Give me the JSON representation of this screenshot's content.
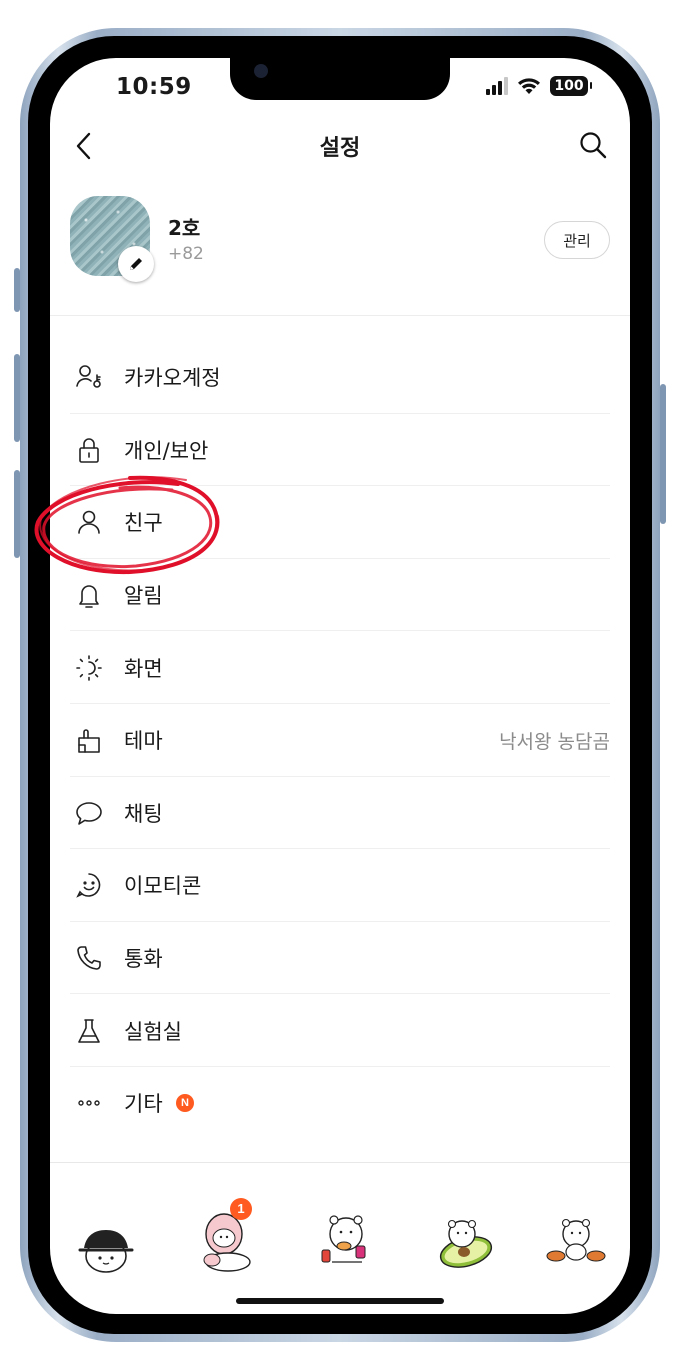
{
  "status_bar": {
    "time": "10:59",
    "battery": "100"
  },
  "nav": {
    "title": "설정",
    "back_icon": "chevron-left-icon",
    "search_icon": "search-icon"
  },
  "profile": {
    "name": "2호",
    "phone": "+82",
    "manage_label": "관리"
  },
  "menu": [
    {
      "label": "카카오계정",
      "icon": "account-key-icon"
    },
    {
      "label": "개인/보안",
      "icon": "lock-icon"
    },
    {
      "label": "친구",
      "icon": "person-icon"
    },
    {
      "label": "알림",
      "icon": "bell-icon"
    },
    {
      "label": "화면",
      "icon": "brightness-icon"
    },
    {
      "label": "테마",
      "icon": "theme-brush-icon",
      "value": "낙서왕 농담곰"
    },
    {
      "label": "채팅",
      "icon": "chat-bubble-icon"
    },
    {
      "label": "이모티콘",
      "icon": "smile-icon"
    },
    {
      "label": "통화",
      "icon": "phone-icon"
    },
    {
      "label": "실험실",
      "icon": "flask-icon"
    },
    {
      "label": "기타",
      "icon": "more-dots-icon",
      "badge": "N"
    }
  ],
  "tabbar": {
    "tabs": [
      {
        "icon": "bear-hat-icon"
      },
      {
        "icon": "bear-chat-icon",
        "badge": "1"
      },
      {
        "icon": "bear-shop-icon"
      },
      {
        "icon": "bear-avocado-icon"
      },
      {
        "icon": "bear-more-icon"
      }
    ]
  },
  "colors": {
    "badge": "#ff5a1f",
    "annotation_circle": "#e0102a",
    "divider": "#efefef",
    "muted_text": "#8b8b8b"
  }
}
